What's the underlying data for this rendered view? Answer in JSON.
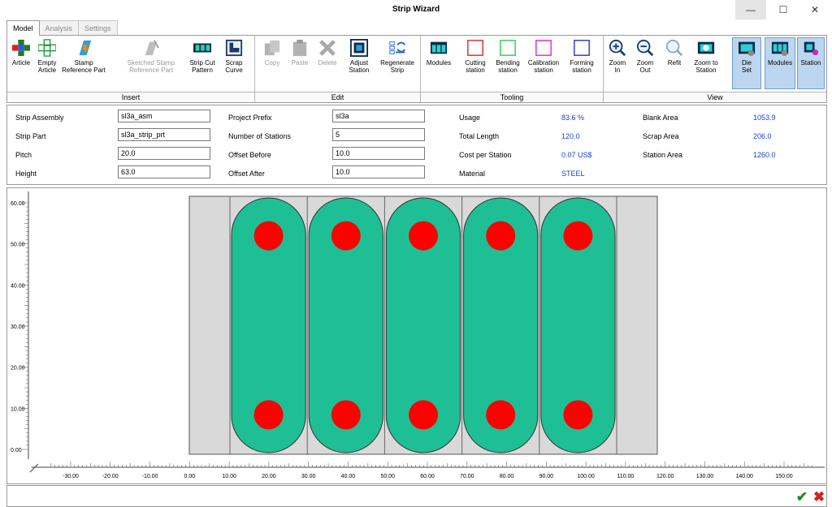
{
  "window": {
    "title": "Strip Wizard",
    "minimize": "—",
    "maximize": "☐",
    "close": "✕"
  },
  "tabs": [
    "Model",
    "Analysis",
    "Settings"
  ],
  "ribbon": {
    "groups": {
      "insert": "Insert",
      "edit": "Edit",
      "tooling": "Tooling",
      "view": "View"
    },
    "insert": [
      {
        "l1": "Article",
        "l2": "",
        "icon": "article-icon"
      },
      {
        "l1": "Empty",
        "l2": "Article",
        "icon": "empty-article-icon"
      },
      {
        "l1": "Stamp",
        "l2": "Reference Part",
        "icon": "stamp-icon"
      },
      {
        "l1": "Sketched Stamp",
        "l2": "Reference Part",
        "icon": "sketched-stamp-icon"
      },
      {
        "l1": "Strip Cut",
        "l2": "Pattern",
        "icon": "strip-cut-icon"
      },
      {
        "l1": "Scrap",
        "l2": "Curve",
        "icon": "scrap-curve-icon"
      }
    ],
    "edit": [
      {
        "l1": "Copy",
        "l2": "",
        "icon": "copy-icon"
      },
      {
        "l1": "Paste",
        "l2": "",
        "icon": "paste-icon"
      },
      {
        "l1": "Delete",
        "l2": "",
        "icon": "delete-icon"
      },
      {
        "l1": "Adjust",
        "l2": "Station",
        "icon": "adjust-station-icon"
      },
      {
        "l1": "Regenerate",
        "l2": "Strip",
        "icon": "regenerate-strip-icon"
      }
    ],
    "tooling": [
      {
        "l1": "Modules",
        "l2": "",
        "icon": "modules-icon"
      },
      {
        "l1": "Cutting",
        "l2": "station",
        "icon": "cutting-station-icon"
      },
      {
        "l1": "Bending",
        "l2": "station",
        "icon": "bending-station-icon"
      },
      {
        "l1": "Calibration",
        "l2": "station",
        "icon": "calibration-station-icon"
      },
      {
        "l1": "Forming",
        "l2": "station",
        "icon": "forming-station-icon"
      }
    ],
    "view": [
      {
        "l1": "Zoom",
        "l2": "In",
        "icon": "zoom-in-icon"
      },
      {
        "l1": "Zoom",
        "l2": "Out",
        "icon": "zoom-out-icon"
      },
      {
        "l1": "Refit",
        "l2": "",
        "icon": "refit-icon"
      },
      {
        "l1": "Zoom to",
        "l2": "Station",
        "icon": "zoom-to-station-icon"
      },
      {
        "l1": "Die",
        "l2": "Set",
        "icon": "die-set-icon"
      },
      {
        "l1": "Modules",
        "l2": "",
        "icon": "modules-view-icon"
      },
      {
        "l1": "Station",
        "l2": "",
        "icon": "station-view-icon"
      }
    ]
  },
  "properties": {
    "strip_assembly": {
      "label": "Strip Assembly",
      "value": "sl3a_asm"
    },
    "strip_part": {
      "label": "Strip Part",
      "value": "sl3a_strip_prt"
    },
    "pitch": {
      "label": "Pitch",
      "value": "20.0"
    },
    "height": {
      "label": "Height",
      "value": "63.0"
    },
    "project_prefix": {
      "label": "Project Prefix",
      "value": "sl3a"
    },
    "num_stations": {
      "label": "Number of Stations",
      "value": "5"
    },
    "offset_before": {
      "label": "Offset Before",
      "value": "10.0"
    },
    "offset_after": {
      "label": "Offset After",
      "value": "10.0"
    },
    "usage": {
      "label": "Usage",
      "value": "83.6 %"
    },
    "total_length": {
      "label": "Total Length",
      "value": "120.0"
    },
    "cost_per_station": {
      "label": "Cost per Station",
      "value": "0.07 US$"
    },
    "material": {
      "label": "Material",
      "value": "STEEL"
    },
    "blank_area": {
      "label": "Blank Area",
      "value": "1053.9"
    },
    "scrap_area": {
      "label": "Scrap Area",
      "value": "206.0"
    },
    "station_area": {
      "label": "Station Area",
      "value": "1260.0"
    }
  },
  "canvas": {
    "y_ticks": [
      "60.00",
      "50.00",
      "40.00",
      "30.00",
      "20.00",
      "10.00",
      "0.00"
    ],
    "x_ticks": [
      "-30.00",
      "-20.00",
      "-10.00",
      "0.00",
      "10.00",
      "20.00",
      "30.00",
      "40.00",
      "50.00",
      "60.00",
      "70.00",
      "80.00",
      "90.00",
      "100.00",
      "110.00",
      "120.00",
      "130.00",
      "140.00",
      "150.00"
    ],
    "blank_color": "#1fbf95",
    "hole_color": "#ff0000",
    "strip_color": "#d9d9d9"
  },
  "footer": {
    "ok": "✔",
    "cancel": "✖"
  }
}
